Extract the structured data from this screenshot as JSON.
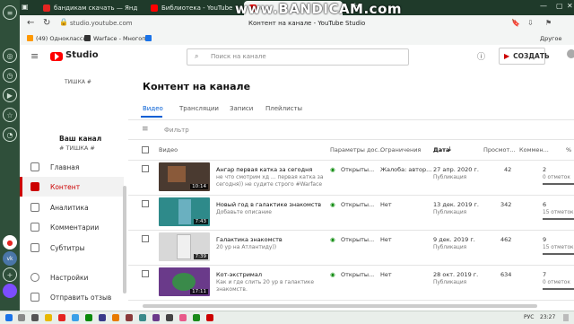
{
  "browser": {
    "tabs": [
      {
        "label": "бандикам скачать — Янд",
        "color": "#e52521"
      },
      {
        "label": "Библиотека - YouTube",
        "color": "#ff0000"
      },
      {
        "label": "Контент на канале - YouTube Studio",
        "color": "#ff0000"
      }
    ],
    "address_host": "studio.youtube.com",
    "page_title": "Контент на канале - YouTube Studio",
    "bookmarks": [
      "(49) Одноклассн",
      "Warface - Многоп"
    ],
    "other_bookmarks": "Другое",
    "watermark": "www.BANDICAM.com"
  },
  "header": {
    "logo_text": "Studio",
    "search_placeholder": "Поиск на канале",
    "create_label": "СОЗДАТЬ"
  },
  "sidebar": {
    "top_text": "ТИШКА #",
    "channel_title": "Ваш канал",
    "channel_name": "# ТИШКА #",
    "items": [
      {
        "label": "Главная",
        "active": false
      },
      {
        "label": "Контент",
        "active": true
      },
      {
        "label": "Аналитика",
        "active": false
      },
      {
        "label": "Комментарии",
        "active": false
      },
      {
        "label": "Субтитры",
        "active": false
      },
      {
        "label": "Настройки",
        "active": false
      },
      {
        "label": "Отправить отзыв",
        "active": false
      }
    ]
  },
  "main": {
    "title": "Контент на канале",
    "tabs": [
      "Видео",
      "Трансляции",
      "Записи",
      "Плейлисты"
    ],
    "filter_label": "Фильтр",
    "columns": [
      "Видео",
      "Параметры дос...",
      "Ограничения",
      "Дата",
      "Просмот...",
      "Коммен...",
      "%"
    ],
    "rows": [
      {
        "title": "Ангар первая катка за сегодня",
        "desc": "не что смотрим хд ... первая катка за сегодня)) не судите строго #Warface",
        "duration": "10:14",
        "access": "Открыты...",
        "restriction": "Жалоба: автор...",
        "date": "27 апр. 2020 г.",
        "date_status": "Публикация",
        "views": "42",
        "comments": "2",
        "pct": "0 отметок",
        "thumb": "#4a3a30"
      },
      {
        "title": "Новый год в галактике знакомств",
        "desc": "Добавьте описание",
        "duration": "7:43",
        "access": "Открыты...",
        "restriction": "Нет",
        "date": "13 дек. 2019 г.",
        "date_status": "Публикация",
        "views": "342",
        "comments": "6",
        "pct": "15 отметок",
        "thumb": "#2e8a8a"
      },
      {
        "title": "Галактика знакомств",
        "desc": "20 ур на Атлантиду))",
        "duration": "7:39",
        "access": "Открыты...",
        "restriction": "Нет",
        "date": "9 дек. 2019 г.",
        "date_status": "Публикация",
        "views": "462",
        "comments": "9",
        "pct": "15 отметок",
        "thumb": "#d8d8d8"
      },
      {
        "title": "Кот-экстримал",
        "desc": "Как и где слить 20 ур в галактике знакомств.",
        "duration": "17:11",
        "access": "Открыты...",
        "restriction": "Нет",
        "date": "28 окт. 2019 г.",
        "date_status": "Публикация",
        "views": "634",
        "comments": "7",
        "pct": "0 отметок",
        "thumb": "#6a3a8a"
      }
    ]
  },
  "taskbar": {
    "lang": "РУС",
    "time": "23:27"
  }
}
